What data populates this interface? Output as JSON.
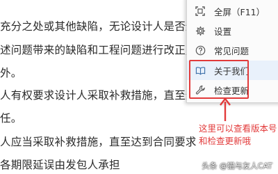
{
  "document": {
    "lines": [
      "充分之处或其他缺陷，无论设计人是否通",
      "述问题带来的缺陷和工程问题进行改正,",
      "外。",
      "人有权要求设计人采取补救措施，直至达",
      "任。",
      "人应当采取补救措施，直至达到合同要求",
      "各期限延误由发包人承担"
    ]
  },
  "menu": {
    "items": [
      {
        "label": "全屏（F11）",
        "icon": "fullscreen-icon"
      },
      {
        "label": "设置",
        "icon": "gear-icon"
      },
      {
        "label": "常见问题",
        "icon": "question-icon"
      },
      {
        "label": "关于我们",
        "icon": "book-icon"
      },
      {
        "label": "检查更新",
        "icon": "wrench-icon"
      }
    ]
  },
  "annotation": {
    "lines": [
      "这里可以查看版本号",
      "和检查更新哦"
    ],
    "color": "#e23a3a"
  },
  "watermark": "头条 @猫与友人CAT"
}
